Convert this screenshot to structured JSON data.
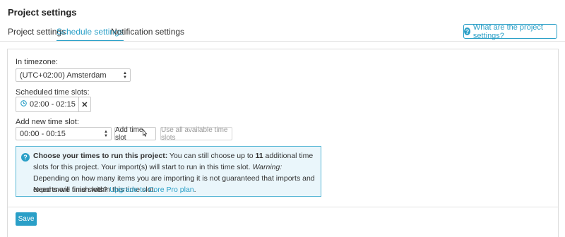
{
  "page": {
    "title": "Project settings"
  },
  "tabs": [
    {
      "label": "Project settings",
      "active": false
    },
    {
      "label": "Schedule settings",
      "active": true
    },
    {
      "label": "Notification settings",
      "active": false
    }
  ],
  "help_button": {
    "label": "What are the project settings?",
    "icon": "question-circle-icon"
  },
  "timezone": {
    "label": "In timezone:",
    "value": "(UTC+02:00) Amsterdam"
  },
  "scheduled": {
    "label": "Scheduled time slots:",
    "slots": [
      {
        "value": "02:00 - 02:15",
        "icon": "clock-icon",
        "remove_icon": "close-icon"
      }
    ]
  },
  "add_new": {
    "label": "Add new time slot:",
    "select_value": "00:00 - 00:15",
    "add_button": "Add time slot",
    "use_all_button": "Use all available time slots"
  },
  "info": {
    "icon": "question-circle-icon",
    "bold": "Choose your times to run this project:",
    "text1": " You can still choose up to ",
    "count": "11",
    "text2": " additional time slots for this project. Your import(s) will start to run in this time slot. ",
    "warning_label": "Warning:",
    "warning_text": " Depending on how many items you are importing it is not guaranteed that imports and exports will finish within this time slot.",
    "more_prefix": "Need more time slots? ",
    "upgrade_link": "Upgrade to Core Pro plan",
    "more_suffix": "."
  },
  "save_button": "Save",
  "colors": {
    "accent": "#2a9fc7",
    "info_bg": "#eaf6fb",
    "info_border": "#5bb8d6"
  }
}
